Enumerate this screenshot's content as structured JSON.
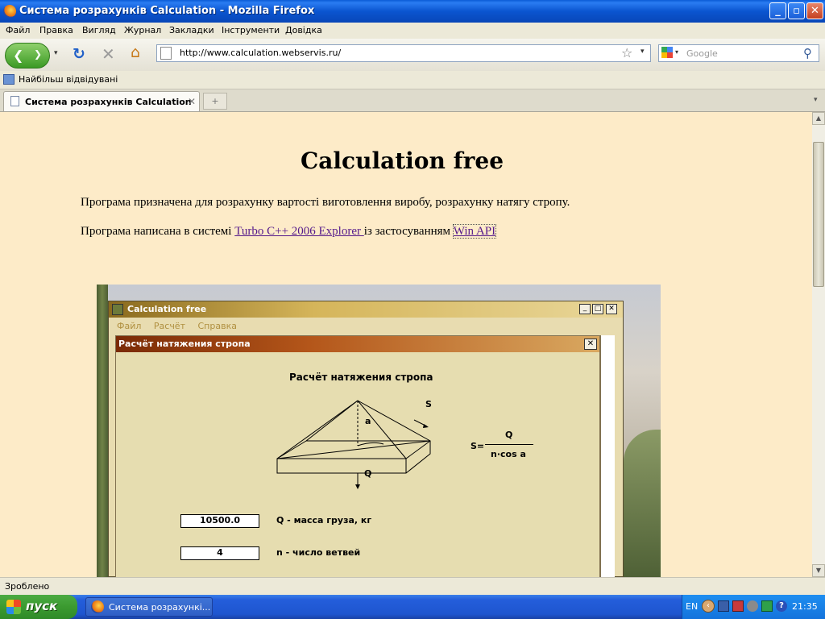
{
  "window": {
    "title": "Система розрахунків Calculation - Mozilla Firefox",
    "minimize": "_",
    "maximize": "▫",
    "close": "✕"
  },
  "menu": [
    "Файл",
    "Правка",
    "Вигляд",
    "Журнал",
    "Закладки",
    "Інструменти",
    "Довідка"
  ],
  "nav": {
    "url": "http://www.calculation.webservis.ru/",
    "search_placeholder": "Google"
  },
  "bookmarks": {
    "most_visited": "Найбільш відвідувані"
  },
  "tabs": [
    {
      "label": "Система розрахунків Calculation"
    }
  ],
  "page": {
    "heading": "Calculation free",
    "para1": "Програма призначена для розрахунку вартості виготовлення виробу, розрахунку натягу стропу.",
    "para2_prefix": "Програма написана в системі ",
    "link1": "Turbo C++ 2006 Explorer ",
    "para2_mid": "із застосуванням ",
    "link2": "Win API "
  },
  "app": {
    "title": "Calculation free",
    "menu": [
      "Файл",
      "Расчёт",
      "Справка"
    ],
    "dialog_title": "Расчёт натяжения стропа",
    "diagram_title": "Расчёт натяжения стропа",
    "label_a": "a",
    "label_S": "S",
    "label_Q": "Q",
    "formula_lhs": "S=",
    "formula_num": "Q",
    "formula_den": "n·cos a",
    "field1_value": "10500.0",
    "field1_label": "Q - масса груза, кг",
    "field2_value": "4",
    "field2_label": "n - число ветвей"
  },
  "status": "Зроблено",
  "taskbar": {
    "start": "пуск",
    "item": "Система розрахункі...",
    "lang": "EN",
    "clock": "21:35"
  }
}
